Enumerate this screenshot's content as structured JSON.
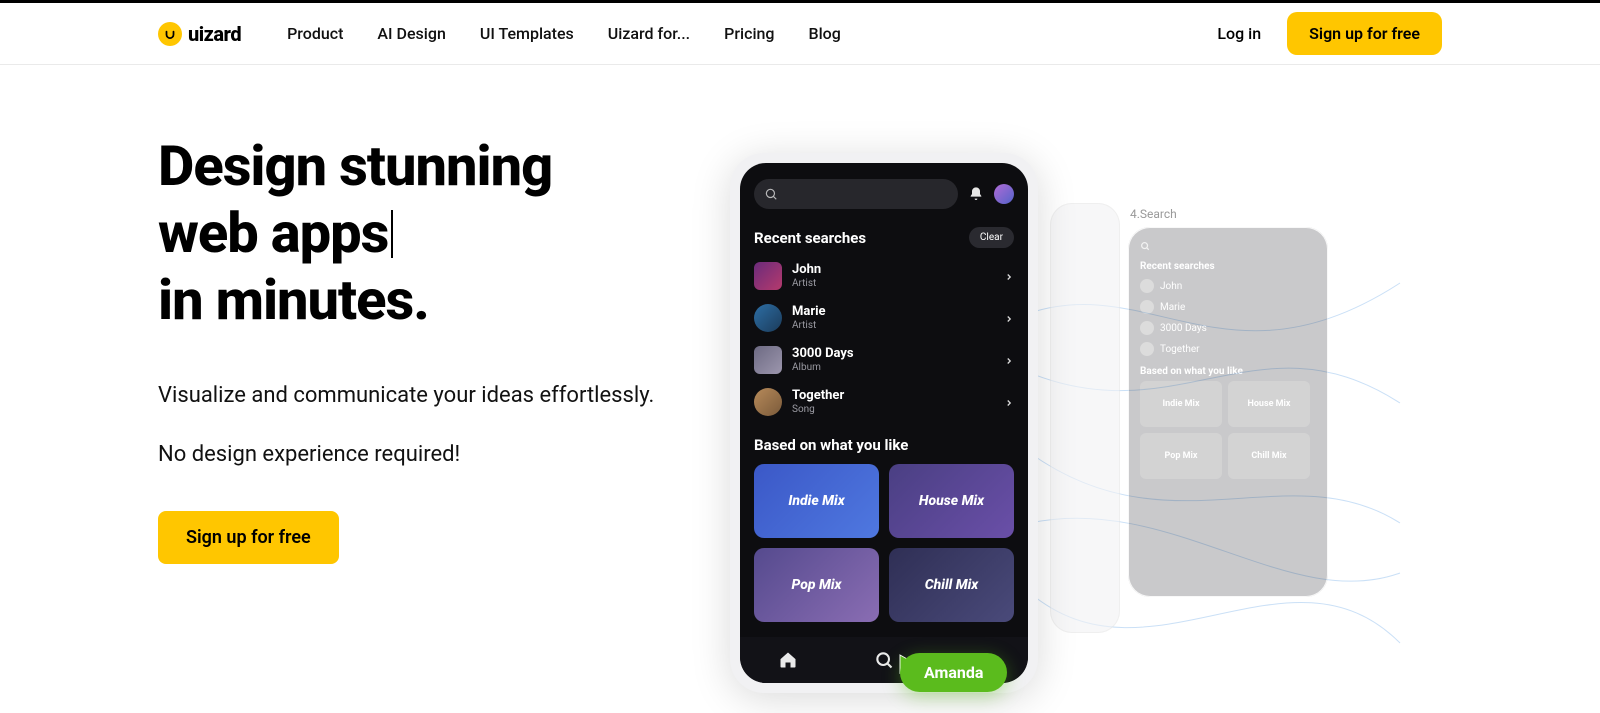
{
  "brand": "uizard",
  "nav": {
    "product": "Product",
    "ai_design": "AI Design",
    "ui_templates": "UI Templates",
    "uizard_for": "Uizard for...",
    "pricing": "Pricing",
    "blog": "Blog"
  },
  "header": {
    "login": "Log in",
    "signup": "Sign up for free"
  },
  "hero": {
    "line1": "Design stunning",
    "line2": "web apps",
    "line3": "in minutes.",
    "sub1": "Visualize and communicate your ideas effortlessly.",
    "sub2": "No design experience required!",
    "cta": "Sign up for free"
  },
  "ghost": {
    "label": "4.Search",
    "recent": "Recent searches",
    "based": "Based on what you like",
    "cards": {
      "indie": "Indie Mix",
      "house": "House Mix",
      "pop": "Pop Mix",
      "chill": "Chill Mix"
    },
    "rows": {
      "john": "John",
      "marie": "Marie",
      "days": "3000 Days",
      "together": "Together"
    }
  },
  "phone": {
    "recent_title": "Recent searches",
    "clear": "Clear",
    "rows": {
      "john": {
        "name": "John",
        "type": "Artist"
      },
      "marie": {
        "name": "Marie",
        "type": "Artist"
      },
      "days": {
        "name": "3000 Days",
        "type": "Album"
      },
      "together": {
        "name": "Together",
        "type": "Song"
      }
    },
    "based_title": "Based on what you like",
    "cards": {
      "indie": "Indie Mix",
      "house": "House Mix",
      "pop": "Pop Mix",
      "chill": "Chill Mix"
    }
  },
  "presence": "Amanda"
}
